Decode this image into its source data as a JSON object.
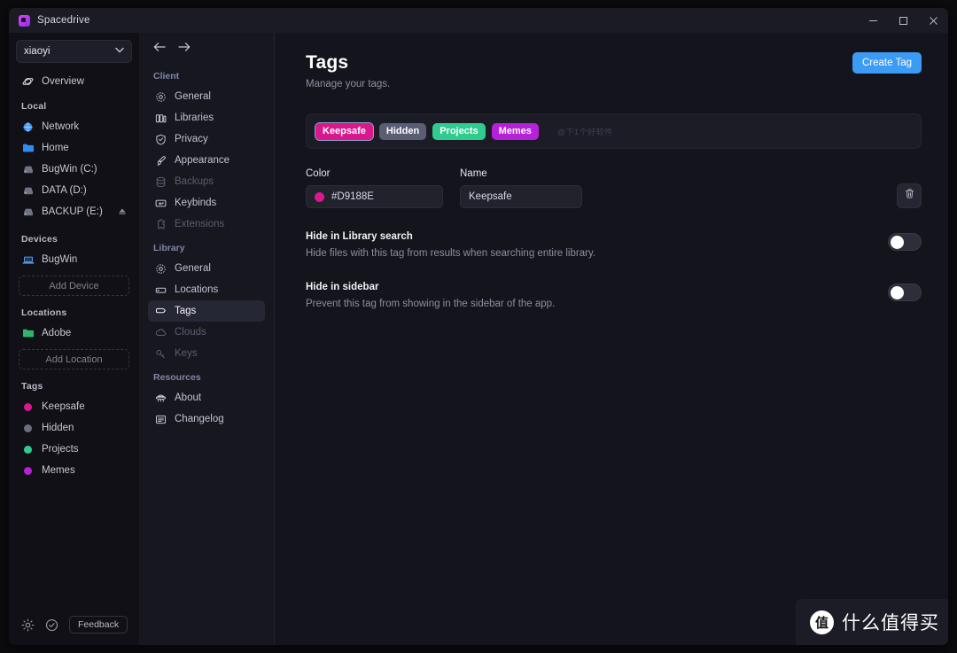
{
  "window": {
    "title": "Spacedrive",
    "controls": {
      "minimize": "minimize-icon",
      "maximize": "maximize-icon",
      "close": "close-icon"
    }
  },
  "sidebar": {
    "library_select": {
      "value": "xiaoyi",
      "chevron": "chevron-down-icon"
    },
    "overview": {
      "label": "Overview",
      "icon": "planet-icon"
    },
    "sections": [
      {
        "title": "Local",
        "items": [
          {
            "label": "Network",
            "icon": "globe-icon",
            "color": "#2f8df2"
          },
          {
            "label": "Home",
            "icon": "folder-icon",
            "color": "#2f8df2"
          },
          {
            "label": "BugWin (C:)",
            "icon": "drive-icon",
            "color": "#6f7282"
          },
          {
            "label": "DATA (D:)",
            "icon": "drive-icon",
            "color": "#6f7282"
          },
          {
            "label": "BACKUP (E:)",
            "icon": "drive-icon",
            "color": "#6f7282",
            "eject": "eject-icon"
          }
        ]
      },
      {
        "title": "Devices",
        "items": [
          {
            "label": "BugWin",
            "icon": "laptop-icon",
            "color": "#4a9bf0"
          }
        ],
        "action": "Add Device"
      },
      {
        "title": "Locations",
        "items": [
          {
            "label": "Adobe",
            "icon": "folder-icon",
            "color": "#2fb56b"
          }
        ],
        "action": "Add Location"
      },
      {
        "title": "Tags",
        "items": [
          {
            "label": "Keepsafe",
            "icon": "dot-icon",
            "color": "#d9188e"
          },
          {
            "label": "Hidden",
            "icon": "dot-icon",
            "color": "#6b6e80"
          },
          {
            "label": "Projects",
            "icon": "dot-icon",
            "color": "#2ecc8f"
          },
          {
            "label": "Memes",
            "icon": "dot-icon",
            "color": "#b520d9"
          }
        ]
      }
    ],
    "bottom": {
      "settings_icon": "gear-icon",
      "status_icon": "check-circle-icon",
      "feedback_label": "Feedback"
    }
  },
  "settings_nav": {
    "back_icon": "arrow-left-icon",
    "forward_icon": "arrow-right-icon",
    "groups": [
      {
        "title": "Client",
        "items": [
          {
            "label": "General",
            "icon": "gear-icon",
            "state": "normal"
          },
          {
            "label": "Libraries",
            "icon": "books-icon",
            "state": "normal"
          },
          {
            "label": "Privacy",
            "icon": "shield-check-icon",
            "state": "normal"
          },
          {
            "label": "Appearance",
            "icon": "paintbrush-icon",
            "state": "normal"
          },
          {
            "label": "Backups",
            "icon": "database-icon",
            "state": "disabled"
          },
          {
            "label": "Keybinds",
            "icon": "keyboard-icon",
            "state": "normal"
          },
          {
            "label": "Extensions",
            "icon": "puzzle-icon",
            "state": "disabled"
          }
        ]
      },
      {
        "title": "Library",
        "items": [
          {
            "label": "General",
            "icon": "gear-icon",
            "state": "normal"
          },
          {
            "label": "Locations",
            "icon": "rectangle-icon",
            "state": "normal"
          },
          {
            "label": "Tags",
            "icon": "tag-icon",
            "state": "active"
          },
          {
            "label": "Clouds",
            "icon": "cloud-icon",
            "state": "disabled"
          },
          {
            "label": "Keys",
            "icon": "key-icon",
            "state": "disabled"
          }
        ]
      },
      {
        "title": "Resources",
        "items": [
          {
            "label": "About",
            "icon": "ufo-icon",
            "state": "normal"
          },
          {
            "label": "Changelog",
            "icon": "note-icon",
            "state": "normal"
          }
        ]
      }
    ]
  },
  "main": {
    "title": "Tags",
    "subtitle": "Manage your tags.",
    "create_button": "Create Tag",
    "tag_pills": [
      {
        "label": "Keepsafe",
        "color": "#d9188e",
        "selected": true
      },
      {
        "label": "Hidden",
        "color": "#5a5e73",
        "selected": false
      },
      {
        "label": "Projects",
        "color": "#2ecc8f",
        "selected": false
      },
      {
        "label": "Memes",
        "color": "#b520d9",
        "selected": false
      }
    ],
    "inline_watermark": "@下1个好软件",
    "fields": {
      "color_label": "Color",
      "color_value": "#D9188E",
      "color_swatch": "#d9188e",
      "name_label": "Name",
      "name_value": "Keepsafe",
      "delete_icon": "trash-icon"
    },
    "settings": [
      {
        "title": "Hide in Library search",
        "desc": "Hide files with this tag from results when searching entire library.",
        "enabled": false
      },
      {
        "title": "Hide in sidebar",
        "desc": "Prevent this tag from showing in the sidebar of the app.",
        "enabled": false
      }
    ]
  },
  "corner_watermark": {
    "badge": "值",
    "text": "什么值得买"
  }
}
